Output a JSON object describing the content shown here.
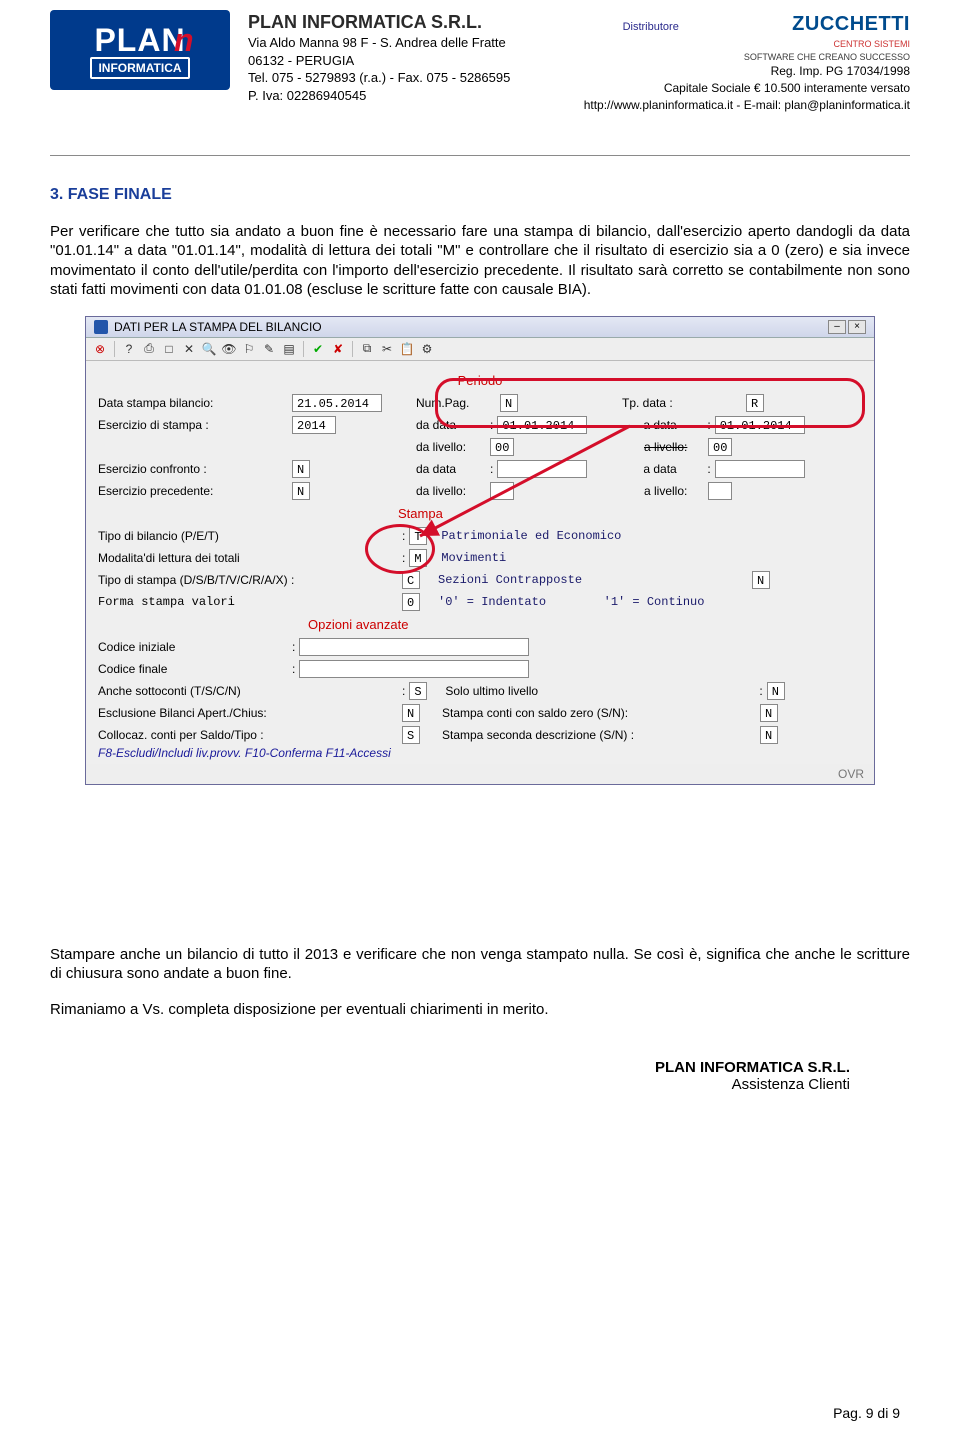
{
  "header": {
    "logo": {
      "main": "PLAN",
      "sub": "INFORMATICA"
    },
    "company_name": "PLAN INFORMATICA S.R.L.",
    "addr1": "Via Aldo Manna 98 F - S. Andrea delle Fratte",
    "addr2": "06132 - PERUGIA",
    "tel": "Tel. 075 - 5279893 (r.a.) - Fax. 075 - 5286595",
    "piva": "P. Iva: 02286940545",
    "distributore": "Distributore",
    "partner": "ZUCCHETTI",
    "partner_sub1": "CENTRO SISTEMI",
    "partner_sub2": "SOFTWARE CHE CREANO SUCCESSO",
    "reg": "Reg. Imp. PG 17034/1998",
    "capitale": "Capitale Sociale € 10.500 interamente versato",
    "web": "http://www.planinformatica.it - E-mail: plan@planinformatica.it"
  },
  "section_title": "3. FASE FINALE",
  "para1": "Per verificare che tutto sia andato a buon fine è necessario fare una stampa di bilancio, dall'esercizio aperto dandogli da data \"01.01.14\" a data \"01.01.14\", modalità di lettura dei totali \"M\" e controllare che il risultato di esercizio sia a 0 (zero) e sia invece movimentato il conto dell'utile/perdita con l'importo dell'esercizio precedente. Il risultato sarà corretto se contabilmente non sono stati fatti movimenti con data 01.01.08 (escluse le scritture fatte con causale BIA).",
  "win": {
    "title": "DATI PER LA STAMPA DEL BILANCIO",
    "periodo": "Periodo",
    "stampa": "Stampa",
    "opzioni": "Opzioni avanzate",
    "rows": {
      "data_stampa_l": "Data stampa bilancio:",
      "data_stampa_v": "21.05.2014",
      "numpag_l": "Num.Pag.",
      "numpag_v": "N",
      "tpdata_l": "Tp. data :",
      "tpdata_v": "R",
      "eserc_l": "Esercizio di stampa :",
      "eserc_v": "2014",
      "dadata_l": "da data",
      "dadata_v": "01.01.2014",
      "adata_l": "a data",
      "adata_v": "01.01.2014",
      "daliv_l": "da livello:",
      "daliv_v": "00",
      "aliv_l": "a livello:",
      "aliv_v": "00",
      "confr_l": "Esercizio confronto :",
      "confr_v": "N",
      "dadata2_l": "da data",
      "adata2_l": "a data",
      "prec_l": "Esercizio precedente:",
      "prec_v": "N",
      "daliv2_l": "da livello:",
      "aliv2_l": "a livello:",
      "tipo_l": "Tipo di bilancio (P/E/T)",
      "tipo_v": "T",
      "tipo_d": "Patrimoniale ed Economico",
      "mod_l": "Modalita'di lettura dei totali",
      "mod_v": "M",
      "mod_d": "Movimenti",
      "tstampa_l": "Tipo di stampa (D/S/B/T/V/C/R/A/X) :",
      "tstampa_v": "C",
      "tstampa_d": "Sezioni Contrapposte",
      "tstampa_n": "N",
      "forma_l": "Forma stampa valori",
      "forma_v": "0",
      "forma_d": "'0' = Indentato        '1' = Continuo",
      "codini_l": "Codice iniziale",
      "codfin_l": "Codice finale",
      "sotto_l": "Anche sottoconti (T/S/C/N)",
      "sotto_v": "S",
      "sotto_d": "Solo ultimo livello",
      "sotto_n": "N",
      "escl_l": "Esclusione Bilanci Apert./Chius:",
      "escl_v": "N",
      "escl_d": "Stampa conti con saldo zero (S/N):",
      "escl_n": "N",
      "coll_l": "Collocaz. conti per Saldo/Tipo :",
      "coll_v": "S",
      "coll_d": "Stampa seconda descrizione (S/N) :",
      "coll_n": "N",
      "hint": "F8-Escludi/Includi liv.provv. F10-Conferma F11-Accessi",
      "ovr": "OVR"
    }
  },
  "para2": "Stampare anche un bilancio di tutto il 2013 e verificare che non venga stampato nulla. Se così è, significa che anche le scritture di chiusura sono andate a buon fine.",
  "para3": "Rimaniamo a  Vs. completa disposizione per eventuali chiarimenti in merito.",
  "signature": {
    "line1": "PLAN INFORMATICA S.R.L.",
    "line2": "Assistenza Clienti"
  },
  "page_footer": "Pag. 9 di 9"
}
